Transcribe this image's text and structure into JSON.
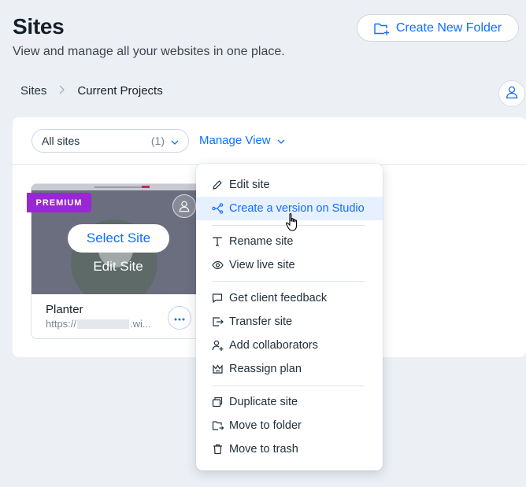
{
  "header": {
    "title": "Sites",
    "subtitle": "View and manage all your websites in one place.",
    "create_folder_label": "Create New Folder"
  },
  "breadcrumb": {
    "root": "Sites",
    "current": "Current Projects"
  },
  "toolbar": {
    "filter_label": "All sites",
    "filter_count": "(1)",
    "manage_view_label": "Manage View"
  },
  "site_card": {
    "badge": "PREMIUM",
    "select_label": "Select Site",
    "edit_label": "Edit Site",
    "name": "Planter",
    "url_prefix": "https://",
    "url_suffix": ".wi..."
  },
  "context_menu": {
    "items": [
      {
        "label": "Edit site",
        "icon": "pencil-icon"
      },
      {
        "label": "Create a version on Studio",
        "icon": "branch-icon",
        "active": true
      },
      {
        "label": "Rename site",
        "icon": "text-icon"
      },
      {
        "label": "View live site",
        "icon": "eye-icon"
      },
      {
        "label": "Get client feedback",
        "icon": "comment-icon"
      },
      {
        "label": "Transfer site",
        "icon": "transfer-icon"
      },
      {
        "label": "Add collaborators",
        "icon": "add-user-icon"
      },
      {
        "label": "Reassign plan",
        "icon": "crown-icon"
      },
      {
        "label": "Duplicate site",
        "icon": "duplicate-icon"
      },
      {
        "label": "Move to folder",
        "icon": "folder-move-icon"
      },
      {
        "label": "Move to trash",
        "icon": "trash-icon"
      }
    ]
  },
  "colors": {
    "accent": "#116dff",
    "premium": "#9a27d5",
    "background": "#ecf0f5",
    "active_item_bg": "#e7f0ff"
  }
}
